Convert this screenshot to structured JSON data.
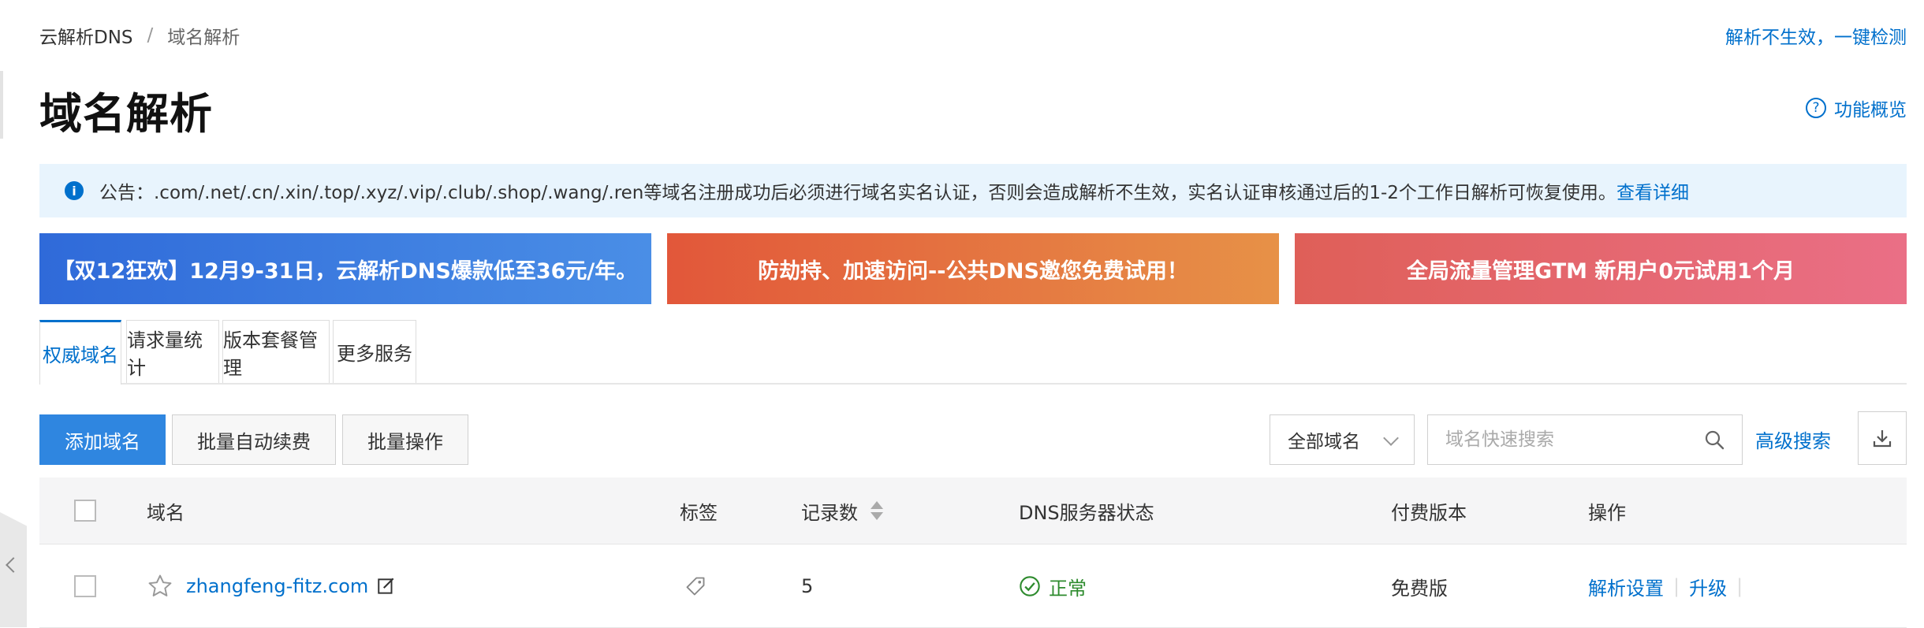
{
  "breadcrumb": {
    "root": "云解析DNS",
    "separator": "/",
    "current": "域名解析"
  },
  "header": {
    "check_link": "解析不生效，一键检测",
    "title": "域名解析",
    "overview_label": "功能概览",
    "overview_icon": "question-circle-icon"
  },
  "notice": {
    "text": "公告：.com/.net/.cn/.xin/.top/.xyz/.vip/.club/.shop/.wang/.ren等域名注册成功后必须进行域名实名认证，否则会造成解析不生效，实名认证审核通过后的1-2个工作日解析可恢复使用。",
    "link": "查看详细",
    "icon": "info-icon"
  },
  "banners": [
    {
      "text": "【双12狂欢】12月9-31日，云解析DNS爆款低至36元/年。",
      "color_start": "#2f6ad9",
      "color_end": "#4a8ee6"
    },
    {
      "text": "防劫持、加速访问--公共DNS邀您免费试用！",
      "color_start": "#e2573a",
      "color_end": "#e79147"
    },
    {
      "text": "全局流量管理GTM 新用户0元试用1个月",
      "color_start": "#df5f58",
      "color_end": "#ea6f86"
    }
  ],
  "tabs": [
    {
      "label": "权威域名",
      "active": true
    },
    {
      "label": "请求量统计",
      "active": false
    },
    {
      "label": "版本套餐管理",
      "active": false
    },
    {
      "label": "更多服务",
      "active": false
    }
  ],
  "toolbar": {
    "add_domain": "添加域名",
    "batch_renew": "批量自动续费",
    "batch_ops": "批量操作",
    "filter_selected": "全部域名",
    "search_placeholder": "域名快速搜索",
    "advanced_search": "高级搜索"
  },
  "table": {
    "columns": {
      "domain": "域名",
      "tag": "标签",
      "records": "记录数",
      "dns_status": "DNS服务器状态",
      "plan": "付费版本",
      "actions": "操作"
    },
    "rows": [
      {
        "domain": "zhangfeng-fitz.com",
        "records": "5",
        "dns_status": "正常",
        "plan": "免费版",
        "action_1": "解析设置",
        "action_2": "升级"
      }
    ]
  },
  "colors": {
    "accent": "#0070cc",
    "primary_button": "#2f86e0",
    "status_ok": "#2e8b2e"
  }
}
